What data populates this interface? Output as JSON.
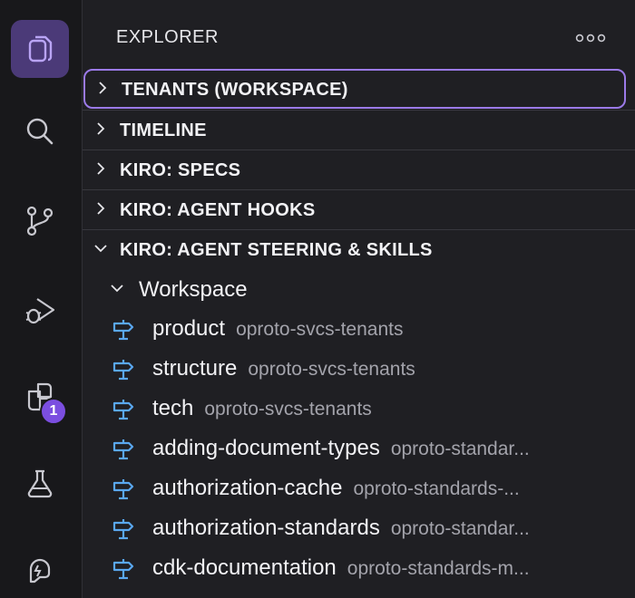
{
  "activity_bar": {
    "items": [
      {
        "icon": "files-icon",
        "active": true
      },
      {
        "icon": "search-icon"
      },
      {
        "icon": "source-control-icon"
      },
      {
        "icon": "run-debug-icon"
      },
      {
        "icon": "extensions-icon",
        "badge": "1"
      },
      {
        "icon": "testing-flask-icon"
      },
      {
        "icon": "kiro-ghost-icon"
      }
    ],
    "accent_color": "#7b4ee0"
  },
  "sidebar": {
    "title": "EXPLORER",
    "more_icon": "ellipsis-icon",
    "sections": [
      {
        "label": "TENANTS (WORKSPACE)",
        "expanded": false,
        "focused": true
      },
      {
        "label": "TIMELINE",
        "expanded": false
      },
      {
        "label": "KIRO: SPECS",
        "expanded": false
      },
      {
        "label": "KIRO: AGENT HOOKS",
        "expanded": false
      },
      {
        "label": "KIRO: AGENT STEERING & SKILLS",
        "expanded": true
      }
    ],
    "group": {
      "label": "Workspace",
      "expanded": true
    },
    "files": [
      {
        "name": "product",
        "desc": "oproto-svcs-tenants"
      },
      {
        "name": "structure",
        "desc": "oproto-svcs-tenants"
      },
      {
        "name": "tech",
        "desc": "oproto-svcs-tenants"
      },
      {
        "name": "adding-document-types",
        "desc": "oproto-standar..."
      },
      {
        "name": "authorization-cache",
        "desc": "oproto-standards-..."
      },
      {
        "name": "authorization-standards",
        "desc": "oproto-standar..."
      },
      {
        "name": "cdk-documentation",
        "desc": "oproto-standards-m..."
      }
    ],
    "focus_color": "#9b7ae8",
    "signpost_color": "#5aa8f0"
  }
}
